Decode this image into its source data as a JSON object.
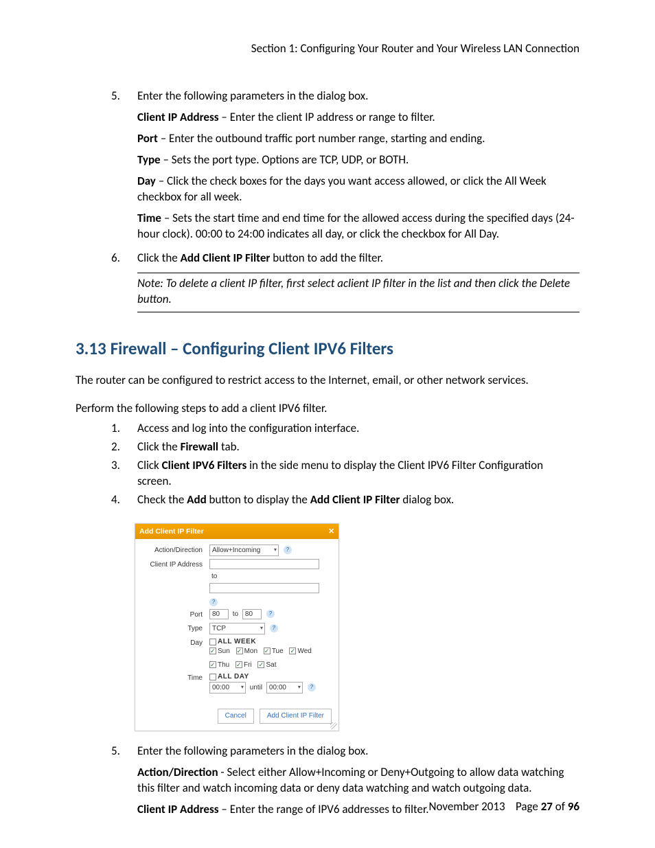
{
  "header": {
    "section": "Section 1:  Configuring Your Router and Your Wireless LAN Connection"
  },
  "list1": {
    "item5": {
      "num": "5.",
      "intro": "Enter the following parameters in the dialog box.",
      "params": {
        "client_ip_label": "Client IP Address",
        "client_ip_text": " – Enter the client IP address or range to filter.",
        "port_label": "Port",
        "port_text": " – Enter the outbound traffic port number range, starting and ending.",
        "type_label": "Type",
        "type_text": " – Sets the port type.  Options are TCP, UDP, or BOTH.",
        "day_label": "Day",
        "day_text": " – Click the check boxes for the days you want access allowed, or click the All Week checkbox for all week.",
        "time_label": "Time",
        "time_text": " – Sets the start time and end time for the allowed access during the specified days (24-hour clock).  00:00 to 24:00 indicates all day, or click the checkbox for All Day."
      }
    },
    "item6": {
      "num": "6.",
      "pre": "Click the ",
      "bold": "Add Client IP Filter",
      "post": " button to add the filter.",
      "note": "Note:  To delete a client IP filter, first select aclient IP filter in the list and then click the Delete button."
    }
  },
  "heading": {
    "num": "3.13",
    "title": "Firewall – Configuring Client IPV6 Filters"
  },
  "body": {
    "intro": "The router can be configured to restrict access to the Internet, email, or other network services.",
    "perform": "Perform the following steps to add a client IPV6 filter."
  },
  "list2": {
    "i1": {
      "num": "1.",
      "text": "Access and log into the configuration interface."
    },
    "i2": {
      "num": "2.",
      "pre": "Click the ",
      "bold": "Firewall",
      "post": " tab."
    },
    "i3": {
      "num": "3.",
      "pre": "Click ",
      "bold": "Client IPV6 Filters",
      "post": " in the side menu to display the Client IPV6 Filter Configuration screen."
    },
    "i4": {
      "num": "4.",
      "pre": "Check the ",
      "bold1": "Add",
      "mid": " button to display the ",
      "bold2": "Add Client IP Filter",
      "post": " dialog box."
    }
  },
  "dialog": {
    "title": "Add Client IP Filter",
    "labels": {
      "action": "Action/Direction",
      "clientip": "Client IP Address",
      "port": "Port",
      "type": "Type",
      "day": "Day",
      "time": "Time"
    },
    "action_value": "Allow+Incoming",
    "to": "to",
    "port_from": "80",
    "port_to": "80",
    "type_value": "TCP",
    "allweek": "ALL WEEK",
    "days": {
      "sun": "Sun",
      "mon": "Mon",
      "tue": "Tue",
      "wed": "Wed",
      "thu": "Thu",
      "fri": "Fri",
      "sat": "Sat"
    },
    "allday": "ALL DAY",
    "time_from": "00:00",
    "until": "until",
    "time_to": "00:00",
    "cancel": "Cancel",
    "add": "Add Client IP Filter",
    "help": "?"
  },
  "list3": {
    "item5": {
      "num": "5.",
      "intro": "Enter the following parameters in the dialog box.",
      "action_label": "Action/Direction",
      "action_text": " - Select either Allow+Incoming or Deny+Outgoing to allow data watching this filter and watch incoming data or deny data watching and watch outgoing data.",
      "clientip_label": "Client IP Address",
      "clientip_text": " – Enter the range of IPV6 addresses to filter."
    }
  },
  "footer": {
    "date": "November 2013",
    "page_label": "Page ",
    "page_num": "27",
    "of": " of ",
    "total": "96"
  }
}
